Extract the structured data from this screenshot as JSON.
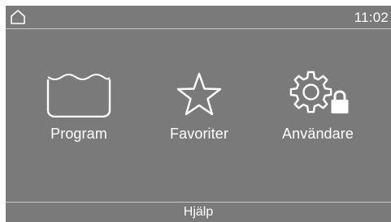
{
  "topbar": {
    "home_icon": "home-icon",
    "time": "11:02"
  },
  "menu": {
    "items": [
      {
        "label": "Program",
        "icon": "wash-tub-icon"
      },
      {
        "label": "Favoriter",
        "icon": "star-icon"
      },
      {
        "label": "Användare",
        "icon": "gear-lock-icon"
      }
    ]
  },
  "footer": {
    "help_label": "Hjälp"
  },
  "colors": {
    "background": "#7a7a7a",
    "foreground": "#ffffff",
    "divider": "#c8c8c8"
  }
}
